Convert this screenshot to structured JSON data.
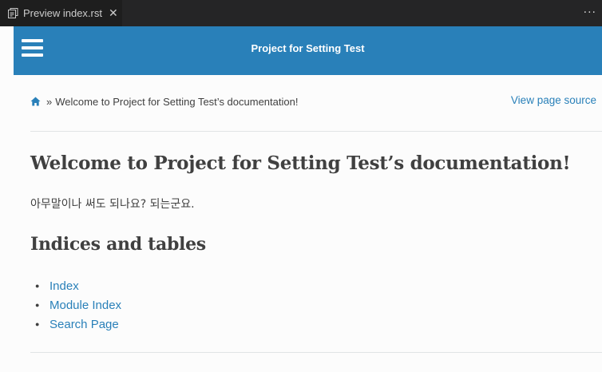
{
  "editor": {
    "tab_label": "Preview index.rst",
    "tab_close": "✕",
    "more_actions": "···"
  },
  "header": {
    "project_title": "Project for Setting Test"
  },
  "breadcrumbs": {
    "separator": "»",
    "current": "Welcome to Project for Setting Test’s documentation!",
    "view_source": "View page source"
  },
  "main": {
    "title": "Welcome to Project for Setting Test’s documentation!",
    "paragraph": "아무말이나 써도 되나요? 되는군요.",
    "section_title": "Indices and tables",
    "links": [
      {
        "label": "Index"
      },
      {
        "label": "Module Index"
      },
      {
        "label": "Search Page"
      }
    ]
  },
  "colors": {
    "accent": "#2980b9",
    "text": "#404040",
    "tabbar": "#252526"
  }
}
